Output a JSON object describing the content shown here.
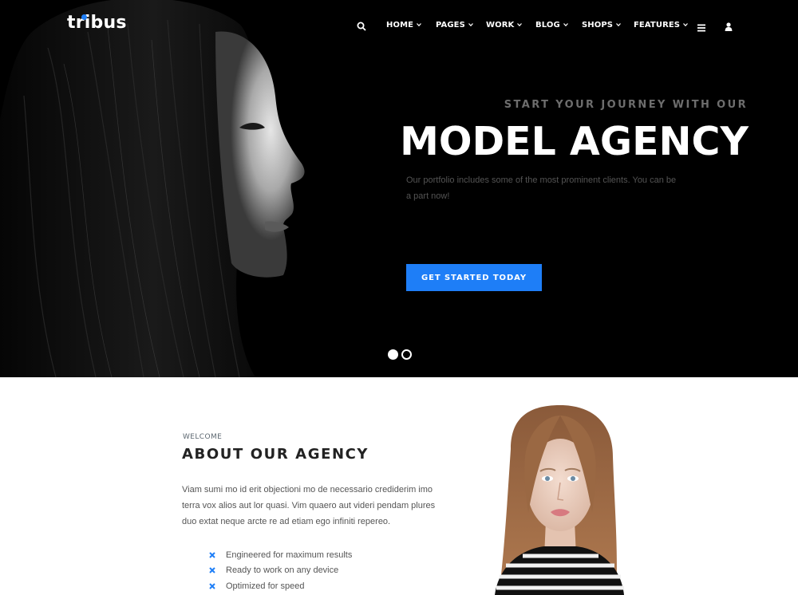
{
  "brand": {
    "logo_text": "tribus",
    "accent_color": "#1e7ef7"
  },
  "nav": {
    "search_icon": "search-icon",
    "items": [
      {
        "label": "HOME"
      },
      {
        "label": "PAGES"
      },
      {
        "label": "WORK"
      },
      {
        "label": "BLOG"
      },
      {
        "label": "SHOPS"
      },
      {
        "label": "FEATURES"
      }
    ],
    "menu_icon": "hamburger-icon",
    "user_icon": "user-icon"
  },
  "hero": {
    "subtitle": "START YOUR JOURNEY WITH OUR",
    "title": "MODEL AGENCY",
    "description": "Our portfolio includes some of the most prominent clients. You can be a part now!",
    "cta_label": "GET STARTED TODAY",
    "slides_total": 2,
    "active_slide": 1
  },
  "about": {
    "eyebrow": "WELCOME",
    "title": "ABOUT OUR AGENCY",
    "text": "Viam sumi mo id erit objectioni mo de necessario crediderim imo terra vox alios aut lor quasi. Vim quaero aut videri pendam plures duo extat neque arcte re ad etiam ego infiniti repereo.",
    "features": [
      "Engineered for maximum results",
      "Ready to work on any device",
      "Optimized for speed"
    ]
  }
}
